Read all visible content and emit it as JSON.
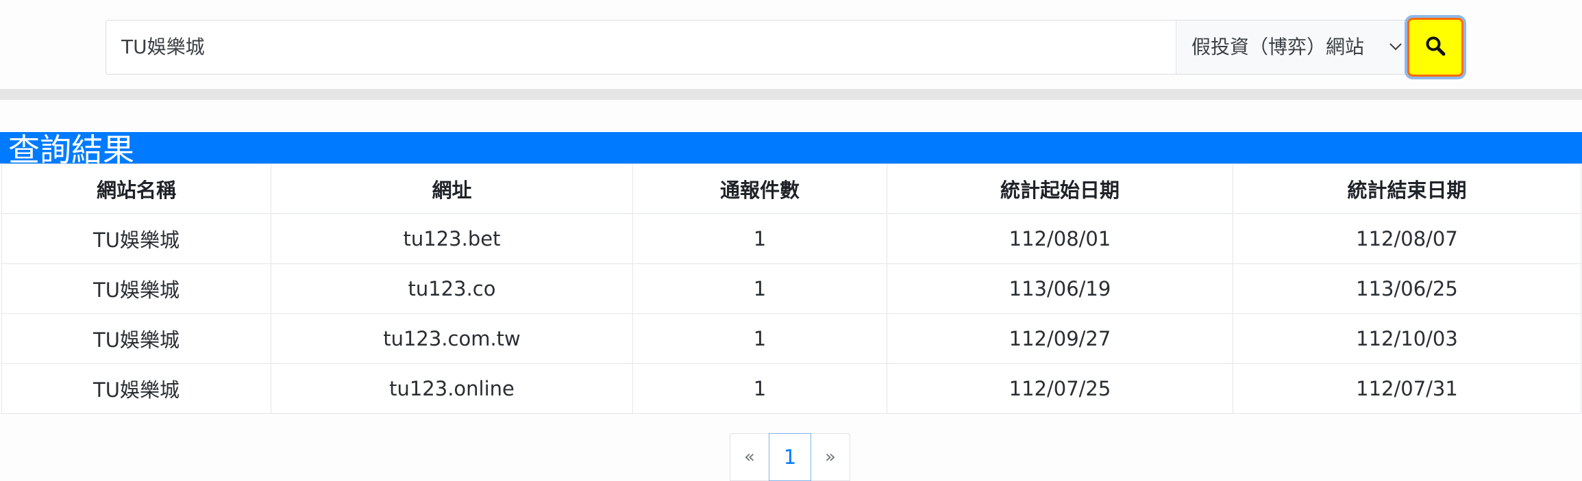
{
  "search": {
    "query": "TU娛樂城",
    "category": "假投資（博弈）網站",
    "category_chevron": "chevron-down-icon",
    "button_icon": "search-icon"
  },
  "results": {
    "title": "查詢結果",
    "columns": [
      "網站名稱",
      "網址",
      "通報件數",
      "統計起始日期",
      "統計結束日期"
    ],
    "rows": [
      [
        "TU娛樂城",
        "tu123.bet",
        "1",
        "112/08/01",
        "112/08/07"
      ],
      [
        "TU娛樂城",
        "tu123.co",
        "1",
        "113/06/19",
        "113/06/25"
      ],
      [
        "TU娛樂城",
        "tu123.com.tw",
        "1",
        "112/09/27",
        "112/10/03"
      ],
      [
        "TU娛樂城",
        "tu123.online",
        "1",
        "112/07/25",
        "112/07/31"
      ]
    ]
  },
  "pagination": {
    "prev": "«",
    "current": "1",
    "next": "»"
  },
  "colors": {
    "title_bar": "#007bff",
    "search_button_bg": "#ffff00",
    "search_button_border": "#ff6a00"
  }
}
